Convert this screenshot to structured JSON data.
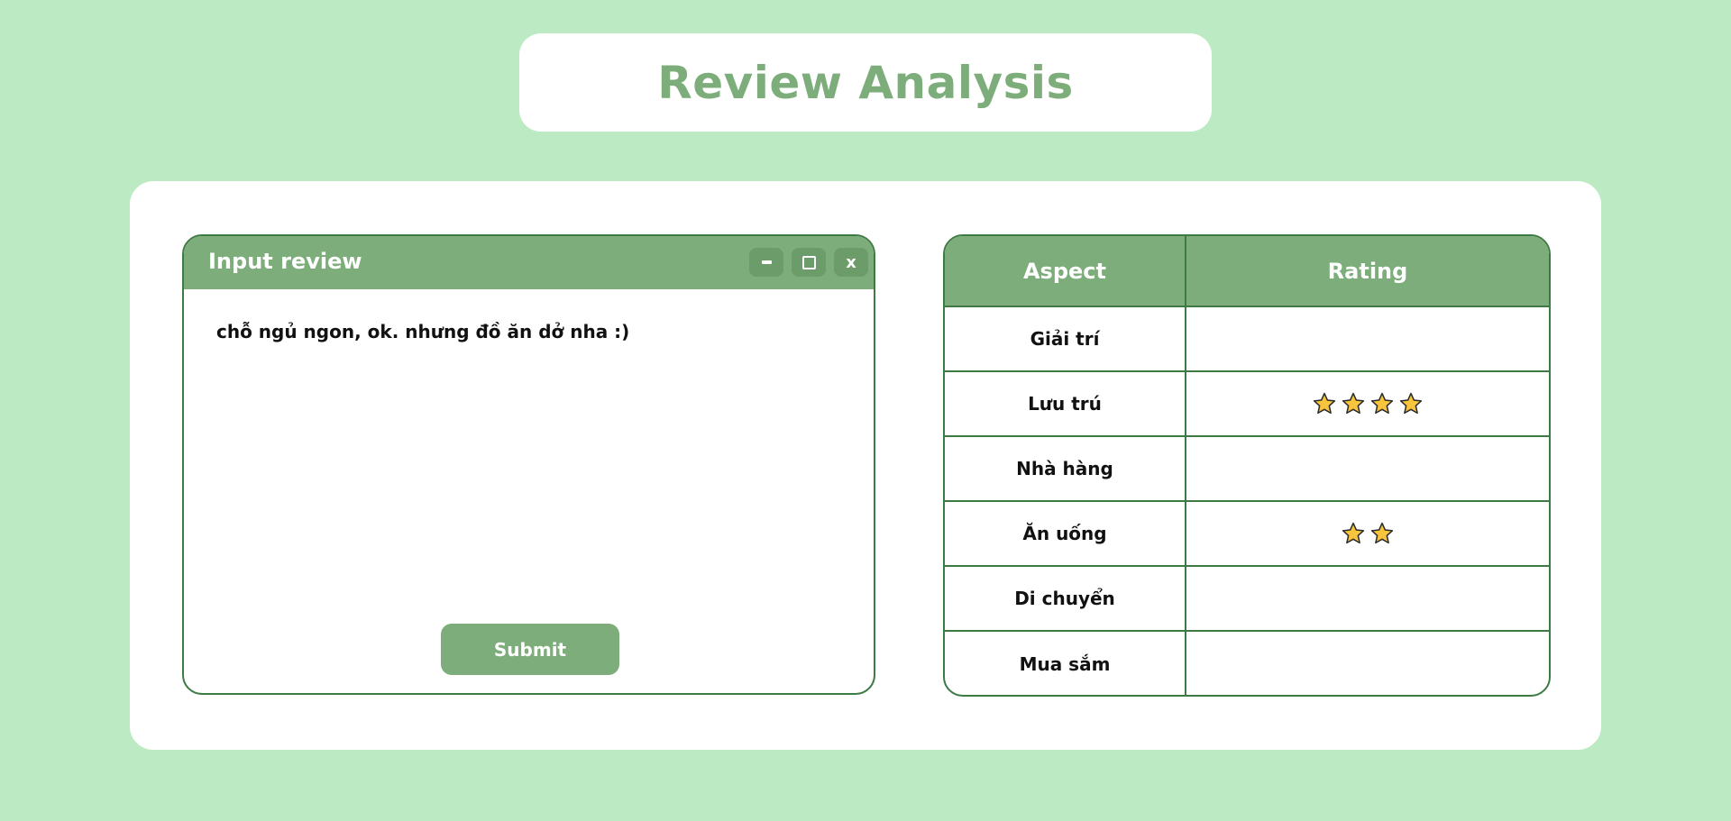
{
  "header": {
    "title": "Review Analysis"
  },
  "input_window": {
    "title": "Input review",
    "review_text": "chỗ ngủ ngon, ok. nhưng đồ ăn dở nha :)",
    "submit_label": "Submit",
    "close_glyph": "x"
  },
  "rating_table": {
    "headers": [
      "Aspect",
      "Rating"
    ],
    "rows": [
      {
        "aspect": "Giải trí",
        "stars": 0
      },
      {
        "aspect": "Lưu trú",
        "stars": 4
      },
      {
        "aspect": "Nhà hàng",
        "stars": 0
      },
      {
        "aspect": "Ăn uống",
        "stars": 2
      },
      {
        "aspect": "Di chuyển",
        "stars": 0
      },
      {
        "aspect": "Mua sắm",
        "stars": 0
      }
    ]
  },
  "colors": {
    "background": "#bcebc3",
    "accent": "#7cad7a",
    "border": "#3e7a44",
    "star_fill": "#f7c43c",
    "star_stroke": "#2b2b2b"
  }
}
